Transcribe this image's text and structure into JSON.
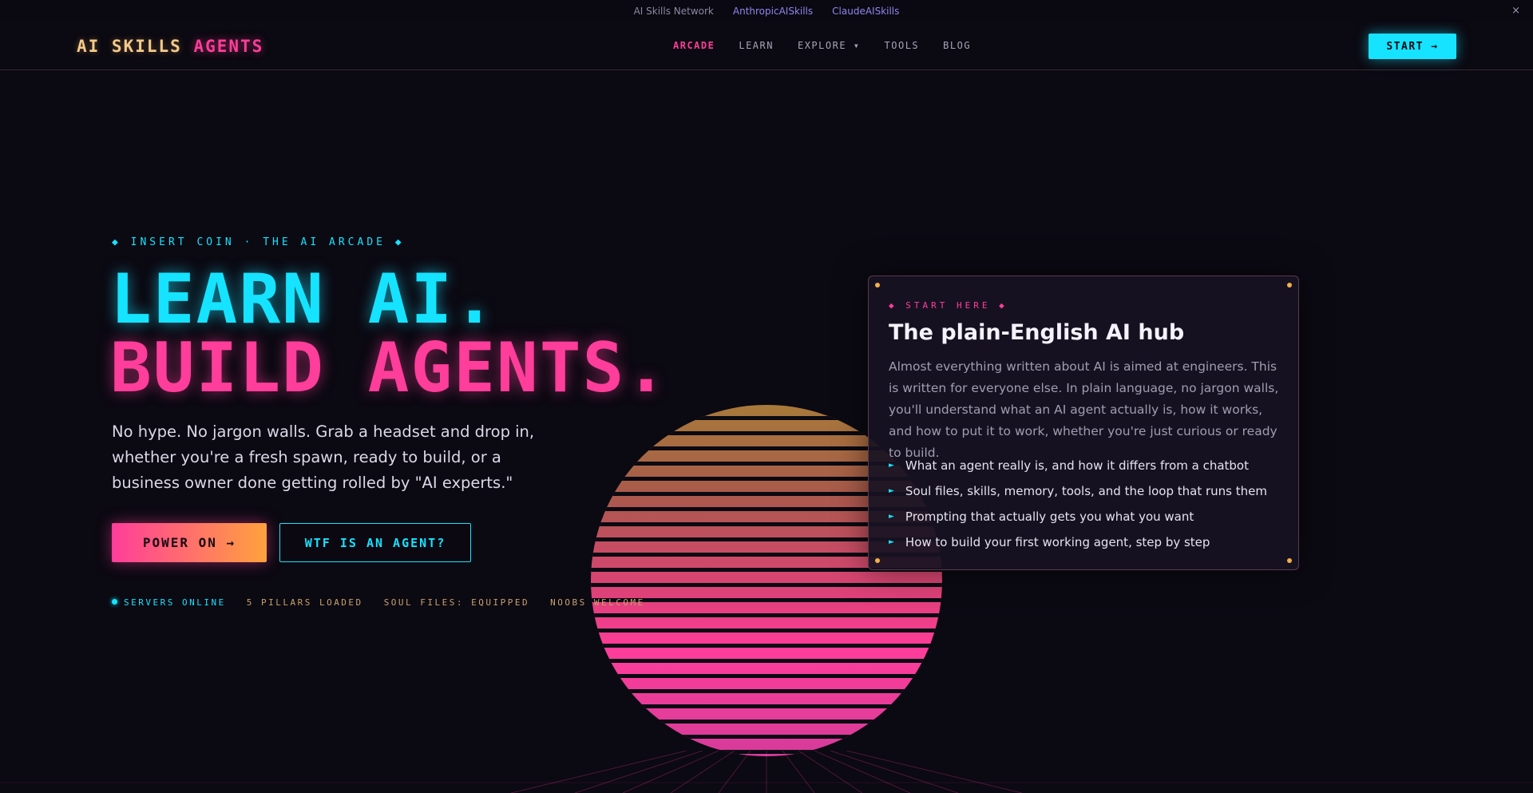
{
  "network": {
    "label": "AI Skills Network",
    "links": [
      "AnthropicAISkills",
      "ClaudeAISkills"
    ],
    "close": "×"
  },
  "header": {
    "logo_a": "AI SKILLS",
    "logo_b": "AGENTS",
    "nav": [
      {
        "label": "ARCADE",
        "active": true
      },
      {
        "label": "LEARN"
      },
      {
        "label": "EXPLORE ▾"
      },
      {
        "label": "TOOLS"
      },
      {
        "label": "BLOG"
      }
    ],
    "start": "START →"
  },
  "hero": {
    "kicker": "◆ INSERT COIN · THE AI ARCADE ◆",
    "line1": "LEARN AI.",
    "line2": "BUILD AGENTS.",
    "lede": "No hype. No jargon walls. Grab a headset and drop in, whether you're a fresh spawn, ready to build, or a business owner done getting rolled by \"AI experts.\"",
    "primary": "POWER ON →",
    "secondary": "WTF IS AN AGENT?",
    "status": [
      "SERVERS ONLINE",
      "5 PILLARS LOADED",
      "SOUL FILES: EQUIPPED",
      "NOOBS WELCOME"
    ]
  },
  "card": {
    "kicker": "◆ START HERE ◆",
    "title": "The plain-English AI hub",
    "body": "Almost everything written about AI is aimed at engineers. This is written for everyone else. In plain language, no jargon walls, you'll understand what an AI agent actually is, how it works, and how to put it to work, whether you're just curious or ready to build.",
    "items": [
      "What an agent really is, and how it differs from a chatbot",
      "Soul files, skills, memory, tools, and the loop that runs them",
      "Prompting that actually gets you what you want",
      "How to build your first working agent, step by step"
    ],
    "bullet": "►"
  },
  "colors": {
    "cyan": "#15e3ff",
    "pink": "#ff3d9a",
    "orange": "#ffa23d",
    "background": "#0b0912"
  }
}
